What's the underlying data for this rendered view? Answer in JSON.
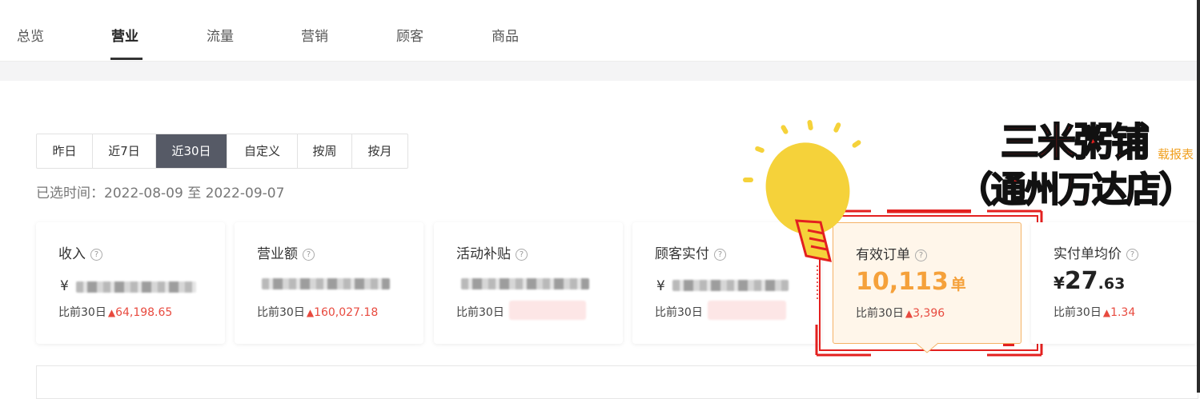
{
  "nav": {
    "tabs": [
      "总览",
      "营业",
      "流量",
      "营销",
      "顾客",
      "商品"
    ],
    "active_index": 1
  },
  "periods": {
    "options": [
      "昨日",
      "近7日",
      "近30日",
      "自定义",
      "按周",
      "按月"
    ],
    "active_index": 2
  },
  "selected_range": "已选时间：2022-08-09 至 2022-09-07",
  "compare_label": "比前30日",
  "help_glyph": "?",
  "up_glyph": "▲",
  "currency": "¥",
  "cards": [
    {
      "title": "收入",
      "delta": "64,198.65"
    },
    {
      "title": "营业额",
      "delta": "160,027.18"
    },
    {
      "title": "活动补贴"
    },
    {
      "title": "顾客实付"
    },
    {
      "title": "有效订单",
      "value": "10,113",
      "unit": "单",
      "delta": "3,396"
    },
    {
      "title": "实付单均价",
      "value_int": "27",
      "value_dec": ".63",
      "delta": "1.34"
    }
  ],
  "overlay": {
    "shop_line1": "三米粥铺",
    "shop_line2": "（通州万达店）",
    "download_hint": "载报表"
  },
  "colors": {
    "accent_red": "#e3201f",
    "up_red": "#e84a3f",
    "order_orange": "#f5a13b",
    "active_period": "#565a66",
    "bulb_yellow": "#f5d23a"
  },
  "icons": [
    "help-icon",
    "arrow-up-icon",
    "lightbulb-icon"
  ]
}
